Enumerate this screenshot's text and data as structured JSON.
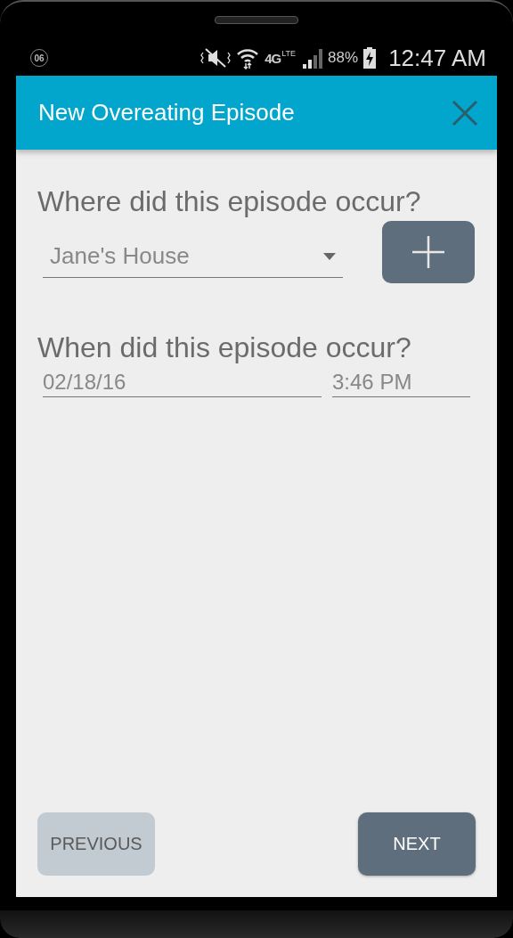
{
  "status_bar": {
    "notification_count": "06",
    "network": "4G",
    "network_sub": "LTE",
    "battery": "88%",
    "time": "12:47 AM"
  },
  "app_bar": {
    "title": "New Overeating Episode"
  },
  "location": {
    "question": "Where did this episode occur?",
    "value": "Jane's House"
  },
  "when": {
    "question": "When did this episode occur?",
    "date": "02/18/16",
    "time": "3:46 PM"
  },
  "buttons": [
    {
      "label": "PREVIOUS",
      "disabled": true
    },
    {
      "label": "NEXT",
      "disabled": false
    }
  ]
}
